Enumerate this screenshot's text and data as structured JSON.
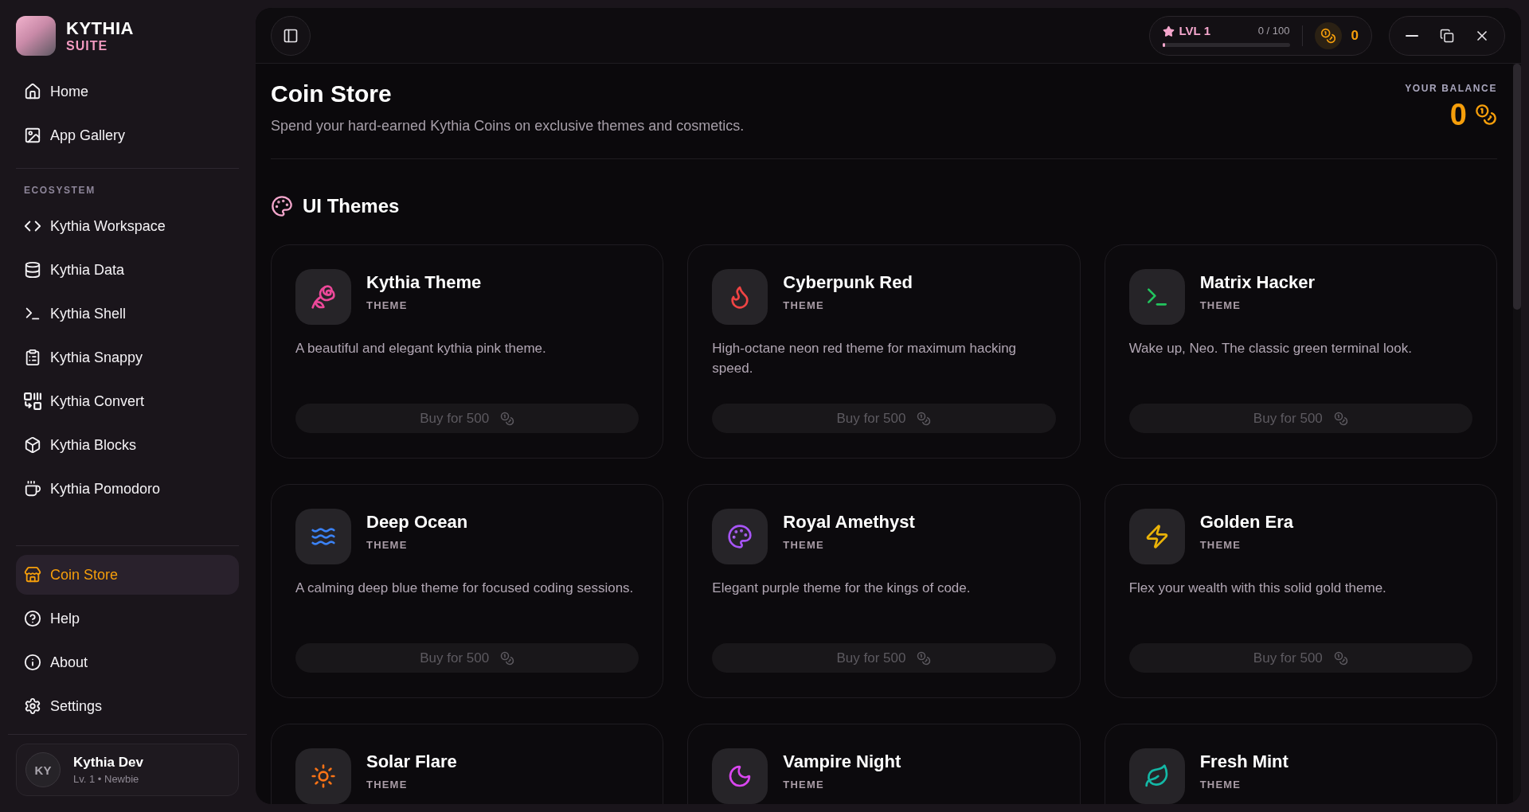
{
  "sidebar": {
    "brand": {
      "title": "KYTHIA",
      "subtitle": "SUITE"
    },
    "main_items": [
      {
        "label": "Home",
        "selected": false
      },
      {
        "label": "App Gallery",
        "selected": false
      }
    ],
    "section_label": "ECOSYSTEM",
    "ecosystem_items": [
      {
        "label": "Kythia Workspace",
        "selected": false
      },
      {
        "label": "Kythia Data",
        "selected": false
      },
      {
        "label": "Kythia Shell",
        "selected": false
      },
      {
        "label": "Kythia Snappy",
        "selected": false
      },
      {
        "label": "Kythia Convert",
        "selected": false
      },
      {
        "label": "Kythia Blocks",
        "selected": false
      },
      {
        "label": "Kythia Pomodoro",
        "selected": false
      }
    ],
    "bottom_items": [
      {
        "label": "Coin Store",
        "selected": true
      },
      {
        "label": "Help",
        "selected": false
      },
      {
        "label": "About",
        "selected": false
      },
      {
        "label": "Settings",
        "selected": false
      }
    ],
    "user": {
      "initials": "KY",
      "name": "Kythia Dev",
      "status": "Lv. 1 • Newbie"
    }
  },
  "topbar": {
    "level": {
      "label": "LVL 1",
      "progress": "0 / 100",
      "level": 0
    },
    "coins": "0"
  },
  "page": {
    "title": "Coin Store",
    "subtitle": "Spend your hard-earned Kythia Coins on exclusive themes and cosmetics.",
    "balance": {
      "label": "YOUR BALANCE",
      "value": "0"
    }
  },
  "section": {
    "title": "UI Themes",
    "items": [
      {
        "name": "Kythia Theme",
        "type": "THEME",
        "description": "A beautiful and elegant kythia pink theme.",
        "button": {
          "label": "Buy for 500",
          "disabled": true
        },
        "color": "#ec4899"
      },
      {
        "name": "Cyberpunk Red",
        "type": "THEME",
        "description": "High-octane neon red theme for maximum hacking speed.",
        "button": {
          "label": "Buy for 500",
          "disabled": true
        },
        "color": "#ef4444"
      },
      {
        "name": "Matrix Hacker",
        "type": "THEME",
        "description": "Wake up, Neo. The classic green terminal look.",
        "button": {
          "label": "Buy for 500",
          "disabled": true
        },
        "color": "#22c55e"
      },
      {
        "name": "Deep Ocean",
        "type": "THEME",
        "description": "A calming deep blue theme for focused coding sessions.",
        "button": {
          "label": "Buy for 500",
          "disabled": true
        },
        "color": "#3b82f6"
      },
      {
        "name": "Royal Amethyst",
        "type": "THEME",
        "description": "Elegant purple theme for the kings of code.",
        "button": {
          "label": "Buy for 500",
          "disabled": true
        },
        "color": "#a855f7"
      },
      {
        "name": "Golden Era",
        "type": "THEME",
        "description": "Flex your wealth with this solid gold theme.",
        "button": {
          "label": "Buy for 500",
          "disabled": true
        },
        "color": "#eab308"
      },
      {
        "name": "Solar Flare",
        "type": "THEME",
        "color": "#f97316"
      },
      {
        "name": "Vampire Night",
        "type": "THEME",
        "color": "#d946ef"
      },
      {
        "name": "Fresh Mint",
        "type": "THEME",
        "color": "#14b8a6"
      }
    ]
  }
}
